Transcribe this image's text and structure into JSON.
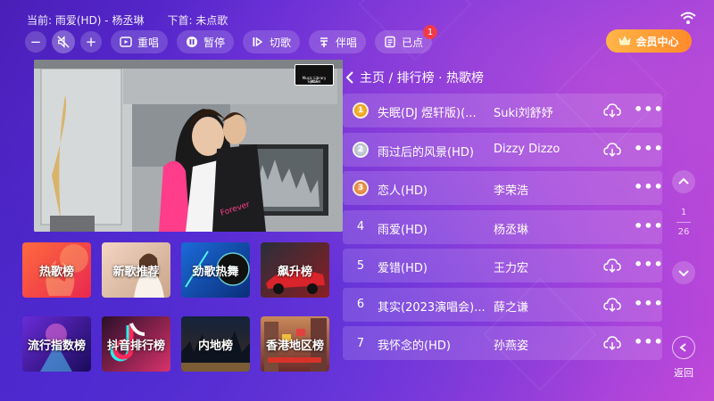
{
  "now_playing": {
    "current_label": "当前: 雨爱(HD) - 杨丞琳",
    "next_label": "下首: 未点歌"
  },
  "toolbar": {
    "vol_down": "−",
    "vol_up": "+",
    "replay_label": "重唱",
    "pause_label": "暂停",
    "next_label": "切歌",
    "accomp_label": "伴唱",
    "queued_label": "已点",
    "queued_count": "1"
  },
  "vip": {
    "label": "会员中心"
  },
  "video": {
    "logo_text": "MLS",
    "logo_subtext": "Music Library System"
  },
  "tiles": [
    {
      "label": "热歌榜"
    },
    {
      "label": "新歌推荐"
    },
    {
      "label": "劲歌热舞"
    },
    {
      "label": "飙升榜"
    },
    {
      "label": "流行指数榜"
    },
    {
      "label": "抖音排行榜"
    },
    {
      "label": "内地榜"
    },
    {
      "label": "香港地区榜"
    }
  ],
  "breadcrumb": {
    "text": "主页 / 排行榜 · 热歌榜"
  },
  "songs": [
    {
      "rank": "1",
      "title": "失眠(DJ 煜轩版)(...",
      "artist": "Suki刘舒妤",
      "medal": "gold",
      "download": true
    },
    {
      "rank": "2",
      "title": "雨过后的风景(HD)",
      "artist": "Dizzy Dizzo",
      "medal": "silver",
      "download": true
    },
    {
      "rank": "3",
      "title": "恋人(HD)",
      "artist": "李荣浩",
      "medal": "bronze",
      "download": false
    },
    {
      "rank": "4",
      "title": "雨爱(HD)",
      "artist": "杨丞琳",
      "medal": "",
      "download": false
    },
    {
      "rank": "5",
      "title": "爱错(HD)",
      "artist": "王力宏",
      "medal": "",
      "download": true
    },
    {
      "rank": "6",
      "title": "其实(2023演唱会)...",
      "artist": "薛之谦",
      "medal": "",
      "download": true
    },
    {
      "rank": "7",
      "title": "我怀念的(HD)",
      "artist": "孙燕姿",
      "medal": "",
      "download": true
    }
  ],
  "pager": {
    "current": "1",
    "total": "26"
  },
  "back": {
    "label": "返回"
  },
  "colors": {
    "accent_orange": "#ff9a33",
    "badge_red": "#f03a4a",
    "bg_purple": "#5b2bd6"
  }
}
